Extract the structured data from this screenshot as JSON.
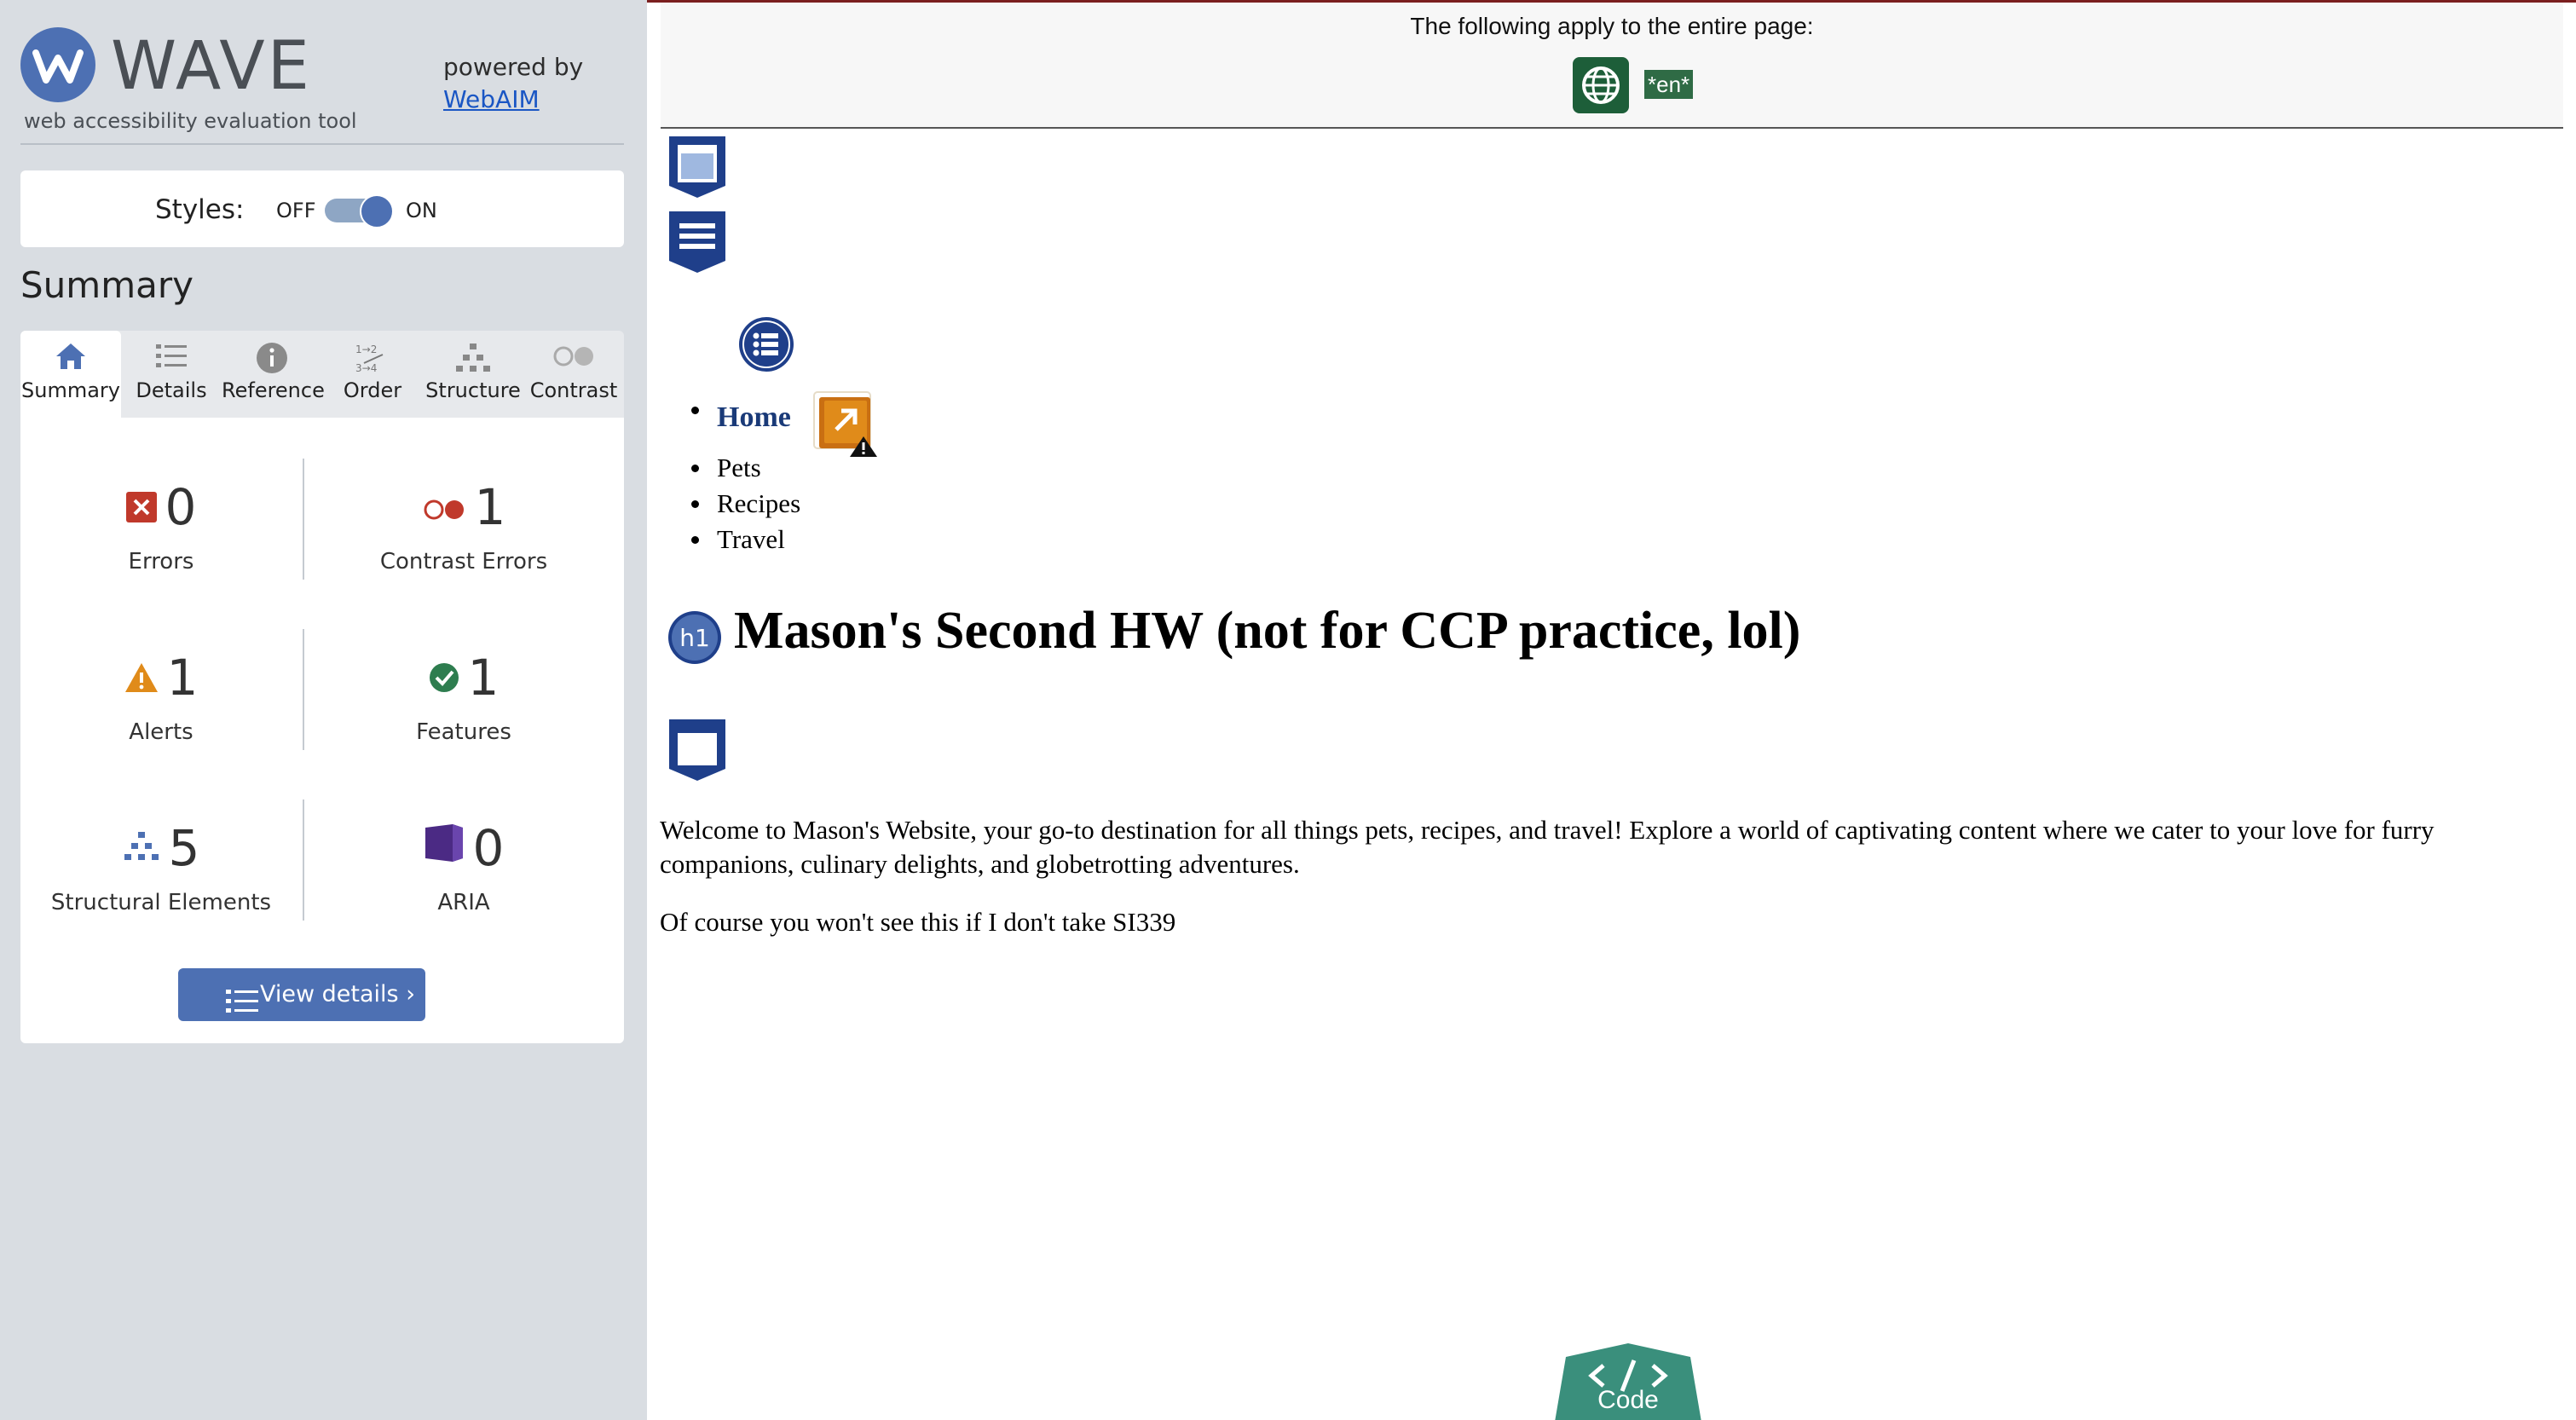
{
  "sidebar": {
    "logo": {
      "word": "WAVE",
      "tagline": "web accessibility evaluation tool"
    },
    "powered_by": {
      "text": "powered by",
      "link": "WebAIM"
    },
    "styles": {
      "label": "Styles:",
      "off": "OFF",
      "on": "ON",
      "state": "on"
    },
    "summary_heading": "Summary",
    "tabs": [
      {
        "label": "Summary",
        "icon": "home-icon",
        "active": true
      },
      {
        "label": "Details",
        "icon": "list-icon"
      },
      {
        "label": "Reference",
        "icon": "info-icon"
      },
      {
        "label": "Order",
        "icon": "order-icon"
      },
      {
        "label": "Structure",
        "icon": "structure-icon"
      },
      {
        "label": "Contrast",
        "icon": "contrast-icon"
      }
    ],
    "stats": {
      "errors": {
        "value": "0",
        "label": "Errors"
      },
      "contrast_errors": {
        "value": "1",
        "label": "Contrast Errors"
      },
      "alerts": {
        "value": "1",
        "label": "Alerts"
      },
      "features": {
        "value": "1",
        "label": "Features"
      },
      "structural": {
        "value": "5",
        "label": "Structural Elements"
      },
      "aria": {
        "value": "0",
        "label": "ARIA"
      }
    },
    "view_details": "View details ›"
  },
  "colors": {
    "accent": "#4d70b3",
    "error": "#c0392b",
    "alert": "#e08b1a",
    "feature": "#2e7d4f",
    "aria": "#4b2a84",
    "sidebar_bg": "#d9dde2"
  },
  "main": {
    "banner_text": "The following apply to the entire page:",
    "lang_tag": "*en*",
    "nav": {
      "home": "Home",
      "items": [
        "Pets",
        "Recipes",
        "Travel"
      ]
    },
    "h1_badge": "h1",
    "heading": "Mason's Second HW (not for CCP practice, lol)",
    "para1": "Welcome to Mason's Website, your go-to destination for all things pets, recipes, and travel! Explore a world of captivating content where we cater to your love for furry companions, culinary delights, and globetrotting adventures.",
    "para2": "Of course you won't see this if I don't take SI339",
    "code_button": "Code"
  }
}
